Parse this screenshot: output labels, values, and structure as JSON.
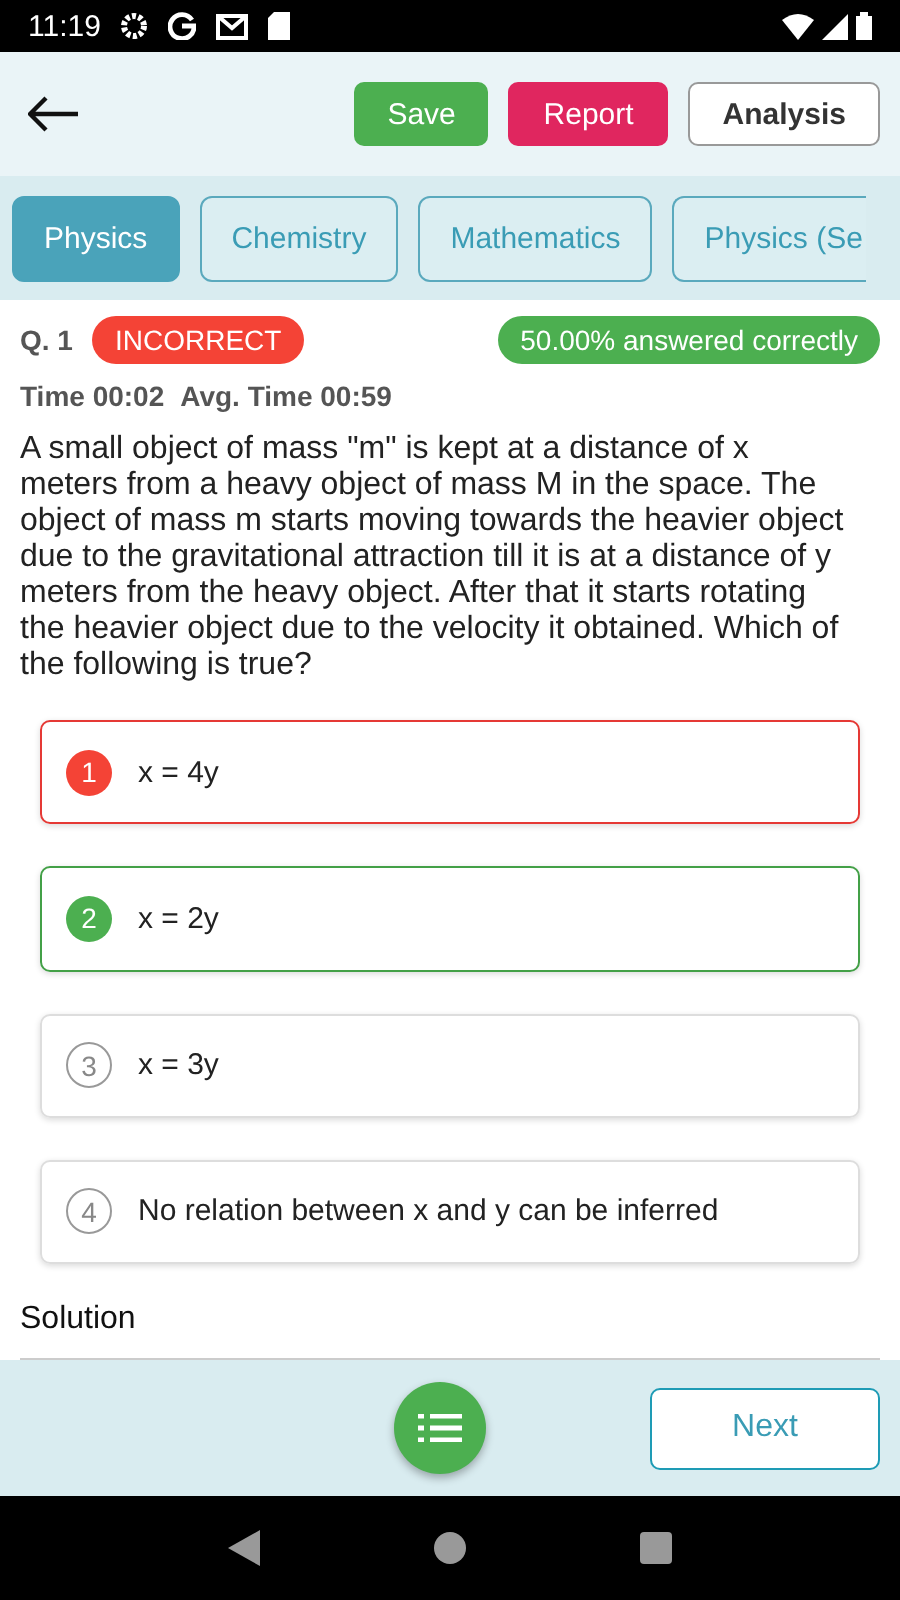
{
  "status_bar": {
    "time": "11:19"
  },
  "header": {
    "buttons": [
      {
        "label": "Save",
        "kind": "save"
      },
      {
        "label": "Report",
        "kind": "report"
      },
      {
        "label": "Analysis",
        "kind": "plain"
      }
    ]
  },
  "tabs": [
    {
      "label": "Physics",
      "selected": true
    },
    {
      "label": "Chemistry",
      "selected": false
    },
    {
      "label": "Mathematics",
      "selected": false
    },
    {
      "label": "Physics (Se",
      "selected": false
    }
  ],
  "question": {
    "number": "Q. 1",
    "result": "INCORRECT",
    "answered": "50.00% answered correctly",
    "time": "Time 00:02",
    "avg_time": "Avg. Time 00:59",
    "text": "A small object of mass \"m\" is kept at a distance of x meters from a heavy object of mass M in the space. The object of mass m starts moving towards the heavier object due to the gravitational attraction till it is at a distance of y meters from the heavy object. After that it starts rotating the heavier object due to the velocity it obtained. Which of the following is true?"
  },
  "options": [
    {
      "number": "1",
      "text": "x = 4y",
      "kind": "wrong"
    },
    {
      "number": "2",
      "text": "x = 2y",
      "kind": "correct"
    },
    {
      "number": "3",
      "text": "x = 3y",
      "kind": "none"
    },
    {
      "number": "4",
      "text": "No relation between x and y can be inferred",
      "kind": "none"
    }
  ],
  "solution": {
    "title": "Solution"
  },
  "footer": {
    "next": "Next"
  }
}
